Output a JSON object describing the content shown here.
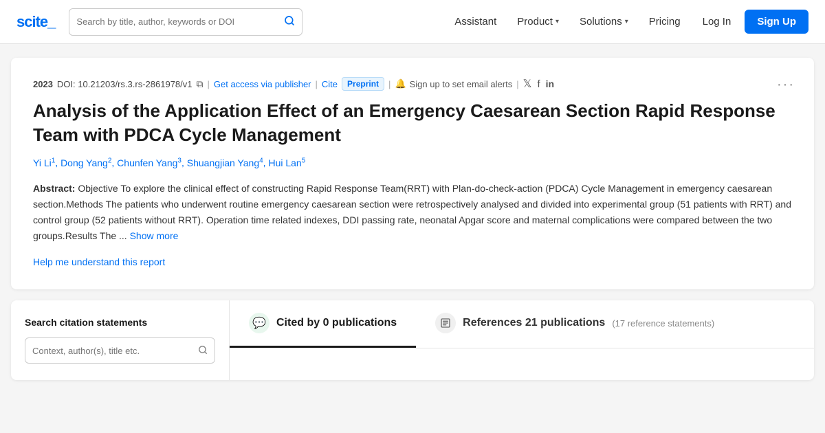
{
  "brand": {
    "name": "scite_",
    "logo_text": "scite",
    "logo_underscore": "_"
  },
  "navbar": {
    "search_placeholder": "Search by title, author, keywords or DOI",
    "assistant_label": "Assistant",
    "product_label": "Product",
    "solutions_label": "Solutions",
    "pricing_label": "Pricing",
    "login_label": "Log In",
    "signup_label": "Sign Up"
  },
  "paper": {
    "year": "2023",
    "doi_label": "DOI:",
    "doi": "10.21203/rs.3.rs-2861978/v1",
    "access_link": "Get access via publisher",
    "cite_label": "Cite",
    "preprint_label": "Preprint",
    "alert_label": "Sign up to set email alerts",
    "title": "Analysis of the Application Effect of an Emergency Caesarean Section Rapid Response Team with PDCA Cycle Management",
    "authors": [
      {
        "name": "Yi Li",
        "sup": "1"
      },
      {
        "name": "Dong Yang",
        "sup": "2"
      },
      {
        "name": "Chunfen Yang",
        "sup": "3"
      },
      {
        "name": "Shuangjian Yang",
        "sup": "4"
      },
      {
        "name": "Hui Lan",
        "sup": "5"
      }
    ],
    "abstract_label": "Abstract:",
    "abstract_text": "Objective To explore the clinical effect of constructing Rapid Response Team(RRT) with Plan-do-check-action (PDCA) Cycle Management in emergency caesarean section.Methods The patients who underwent routine emergency caesarean section were retrospectively analysed and divided into experimental group (51 patients with RRT) and control group (52 patients without RRT). Operation time related indexes, DDI passing rate, neonatal Apgar score and maternal complications were compared between the two groups.Results The ...",
    "show_more_label": "Show more",
    "help_link": "Help me understand this report"
  },
  "citation_panel": {
    "title": "Search citation statements",
    "placeholder": "Context, author(s), title etc."
  },
  "tabs": {
    "cited": {
      "label": "Cited by 0 publications",
      "icon": "💬",
      "active": true
    },
    "references": {
      "label": "References 21 publications",
      "count_info": "(17 reference statements)"
    }
  }
}
